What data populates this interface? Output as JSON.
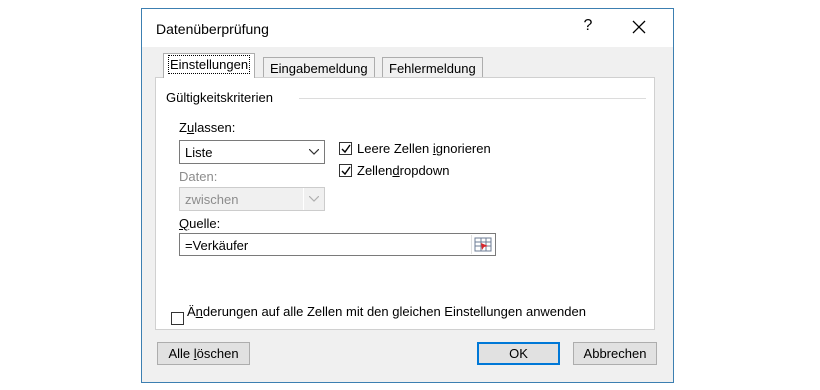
{
  "dialog": {
    "title": "Datenüberprüfung",
    "help": "?",
    "close_icon": "close-icon"
  },
  "tabs": [
    {
      "label": "Einstellungen",
      "active": true
    },
    {
      "label": "Eingabemeldung",
      "active": false
    },
    {
      "label": "Fehlermeldung",
      "active": false
    }
  ],
  "criteria": {
    "group_title": "Gültigkeitskriterien",
    "allow_label_pre": "Z",
    "allow_label_mnemonic": "u",
    "allow_label_post": "lassen:",
    "allow_value": "Liste",
    "data_label": "Daten:",
    "data_value": "zwischen",
    "ignore_blank_pre": "Leere Zellen ",
    "ignore_blank_mnemonic": "i",
    "ignore_blank_post": "gnorieren",
    "ignore_blank_checked": true,
    "dropdown_pre": "Zellen",
    "dropdown_mnemonic": "d",
    "dropdown_post": "ropdown",
    "dropdown_checked": true,
    "source_label_mnemonic": "Q",
    "source_label_post": "uelle:",
    "source_value": "=Verkäufer",
    "ref_icon": "range-selector-icon"
  },
  "apply_all": {
    "pre": "Ä",
    "mnemonic": "n",
    "post": "derungen auf alle Zellen mit den gleichen Einstellungen anwenden",
    "checked": false
  },
  "buttons": {
    "clear_all_pre": "Alle ",
    "clear_all_mnemonic": "l",
    "clear_all_post": "öschen",
    "ok": "OK",
    "cancel": "Abbrechen"
  },
  "colors": {
    "accent": "#0078d7",
    "border": "#3c7fb1",
    "background": "#f0f0f0"
  }
}
